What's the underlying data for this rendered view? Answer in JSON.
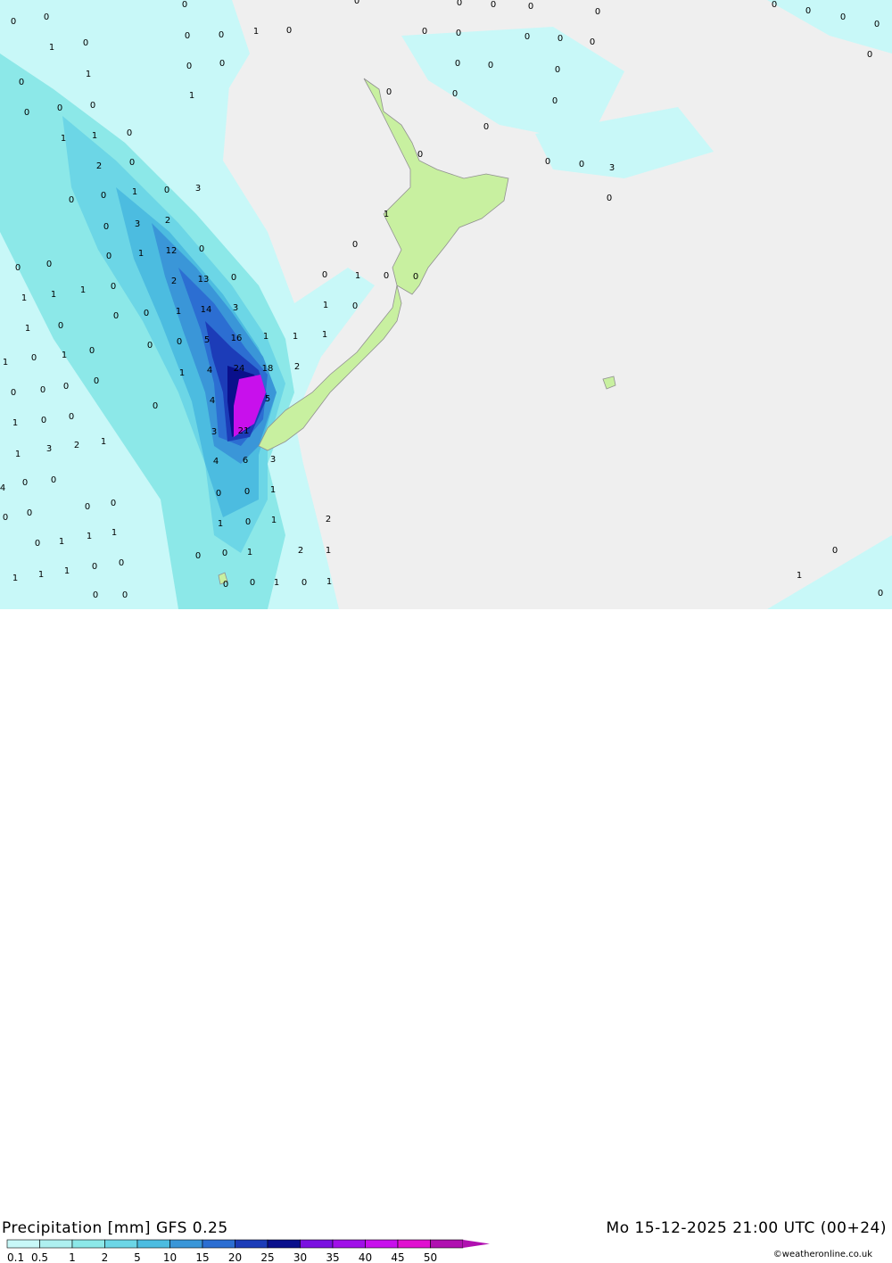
{
  "title": {
    "left": "Precipitation [mm] GFS 0.25",
    "right": "Mo 15-12-2025 21:00 UTC (00+24)"
  },
  "copyright": "©weatheronline.co.uk",
  "legend": {
    "labels": [
      "0.1",
      "0.5",
      "1",
      "2",
      "5",
      "10",
      "15",
      "20",
      "25",
      "30",
      "35",
      "40",
      "45",
      "50"
    ],
    "colors": [
      "#c8f8f8",
      "#aef0f0",
      "#8ce8e8",
      "#6cd6e6",
      "#4cbce0",
      "#3a96d8",
      "#2c6ed2",
      "#1c3cb8",
      "#0a108c",
      "#7a10e0",
      "#a010e8",
      "#c810ec",
      "#e010d0",
      "#b010b0"
    ]
  },
  "map_values": [
    "0",
    "0",
    "0",
    "0",
    "0",
    "0",
    "0",
    "0",
    "0",
    "0",
    "0",
    "0",
    "0",
    "0",
    "0",
    "1",
    "0",
    "1",
    "0",
    "0",
    "0",
    "0",
    "0",
    "0",
    "0",
    "0",
    "0",
    "0",
    "0",
    "1",
    "0",
    "1",
    "0",
    "0",
    "0",
    "0",
    "0",
    "0",
    "0",
    "0",
    "0",
    "0",
    "1",
    "1",
    "0",
    "2",
    "0",
    "3",
    "1",
    "0",
    "3",
    "0",
    "0",
    "0",
    "1",
    "3",
    "2",
    "12",
    "0",
    "0",
    "0",
    "1",
    "0",
    "0",
    "13",
    "0",
    "0",
    "1",
    "1",
    "0",
    "1",
    "0",
    "0",
    "0",
    "2",
    "14",
    "3",
    "1",
    "0",
    "1",
    "0",
    "0",
    "1",
    "5",
    "16",
    "1",
    "1",
    "1",
    "1",
    "0",
    "1",
    "4",
    "24",
    "18",
    "2",
    "0",
    "1",
    "0",
    "0",
    "4",
    "5",
    "0",
    "0",
    "0",
    "0",
    "3",
    "21",
    "0",
    "1",
    "0",
    "0",
    "0",
    "4",
    "6",
    "3",
    "1",
    "1",
    "0",
    "0",
    "1",
    "3",
    "2",
    "1",
    "0",
    "1",
    "2",
    "0",
    "0",
    "0",
    "1",
    "0",
    "0",
    "1",
    "4",
    "0",
    "0",
    "1",
    "0",
    "1",
    "1",
    "2",
    "1",
    "0",
    "1",
    "0",
    "1",
    "1",
    "0",
    "0",
    "0",
    "0",
    "1",
    "0",
    "1",
    "0",
    "0",
    "1",
    "0"
  ]
}
